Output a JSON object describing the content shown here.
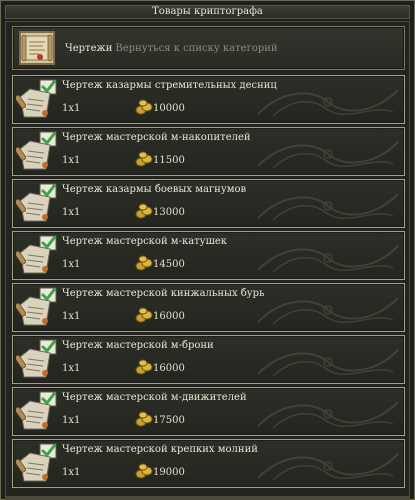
{
  "window": {
    "title": "Товары криптографа"
  },
  "header": {
    "category": "Чертежи",
    "back_link": "Вернуться к списку категорий",
    "icon": "blueprint-scroll-icon"
  },
  "currency_icon": "gold-coins-icon",
  "items": [
    {
      "name": "Чертеж казармы стремительных десниц",
      "qty": "1x1",
      "price": "10000"
    },
    {
      "name": "Чертеж мастерской м-накопителей",
      "qty": "1x1",
      "price": "11500"
    },
    {
      "name": "Чертеж казармы боевых магнумов",
      "qty": "1x1",
      "price": "13000"
    },
    {
      "name": "Чертеж мастерской м-катушек",
      "qty": "1x1",
      "price": "14500"
    },
    {
      "name": "Чертеж мастерской кинжальных бурь",
      "qty": "1x1",
      "price": "16000"
    },
    {
      "name": "Чертеж мастерской м-брони",
      "qty": "1x1",
      "price": "16000"
    },
    {
      "name": "Чертеж мастерской м-движителей",
      "qty": "1x1",
      "price": "17500"
    },
    {
      "name": "Чертеж мастерской крепких молний",
      "qty": "1x1",
      "price": "19000"
    }
  ],
  "colors": {
    "background": "#23241e",
    "border": "#a29f8a",
    "text": "#ece6d6",
    "muted_text": "#8f8b7c",
    "checkmark": "#3ea24a",
    "coin": "#c9a02c"
  }
}
